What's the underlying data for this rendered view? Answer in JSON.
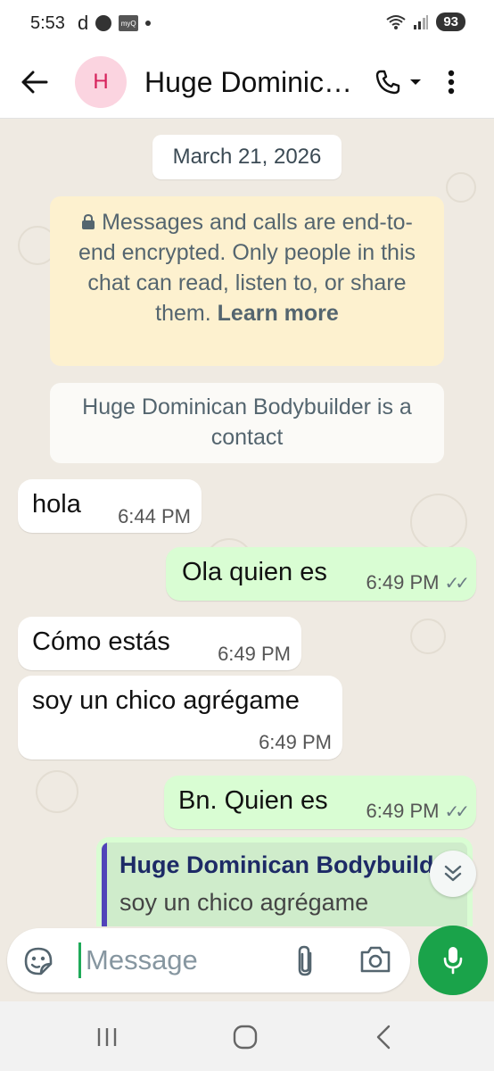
{
  "status_bar": {
    "time": "5:53",
    "carrier_letter": "d",
    "app_icon_text": "myQ",
    "battery": "93"
  },
  "header": {
    "avatar_letter": "H",
    "title": "Huge Dominican Bodybuilder",
    "title_display": "Huge Dominic…"
  },
  "chat": {
    "date_chip": "March 21, 2026",
    "encryption_text": "Messages and calls are end-to-end encrypted. Only people in this chat can read, listen to, or share them.",
    "encryption_link": "Learn more",
    "contact_notice": "Huge Dominican Bodybuilder is a contact",
    "messages": [
      {
        "direction": "incoming",
        "text": "hola",
        "time": "6:44 PM"
      },
      {
        "direction": "outgoing",
        "text": "Ola quien es",
        "time": "6:49 PM",
        "status": "read"
      },
      {
        "direction": "incoming",
        "text": "Cómo estás",
        "time": "6:49 PM"
      },
      {
        "direction": "incoming",
        "text": "soy un chico agrégame",
        "time": "6:49 PM"
      },
      {
        "direction": "outgoing",
        "text": "Bn. Quien es",
        "time": "6:49 PM",
        "status": "read"
      }
    ],
    "reply_preview": {
      "author": "Huge Dominican Bodybuilder",
      "text": "soy un chico agrégame"
    }
  },
  "composer": {
    "placeholder": "Message"
  },
  "colors": {
    "outgoing_bubble": "#d9fdd3",
    "incoming_bubble": "#ffffff",
    "accent": "#1aa34a",
    "notice": "#fdf1cf"
  },
  "icons": [
    "back-arrow-icon",
    "phone-icon",
    "chevron-down-icon",
    "more-vert-icon",
    "lock-icon",
    "double-check-icon",
    "scroll-down-icon",
    "sticker-icon",
    "paperclip-icon",
    "camera-icon",
    "mic-icon",
    "recents-icon",
    "home-icon",
    "back-nav-icon"
  ]
}
